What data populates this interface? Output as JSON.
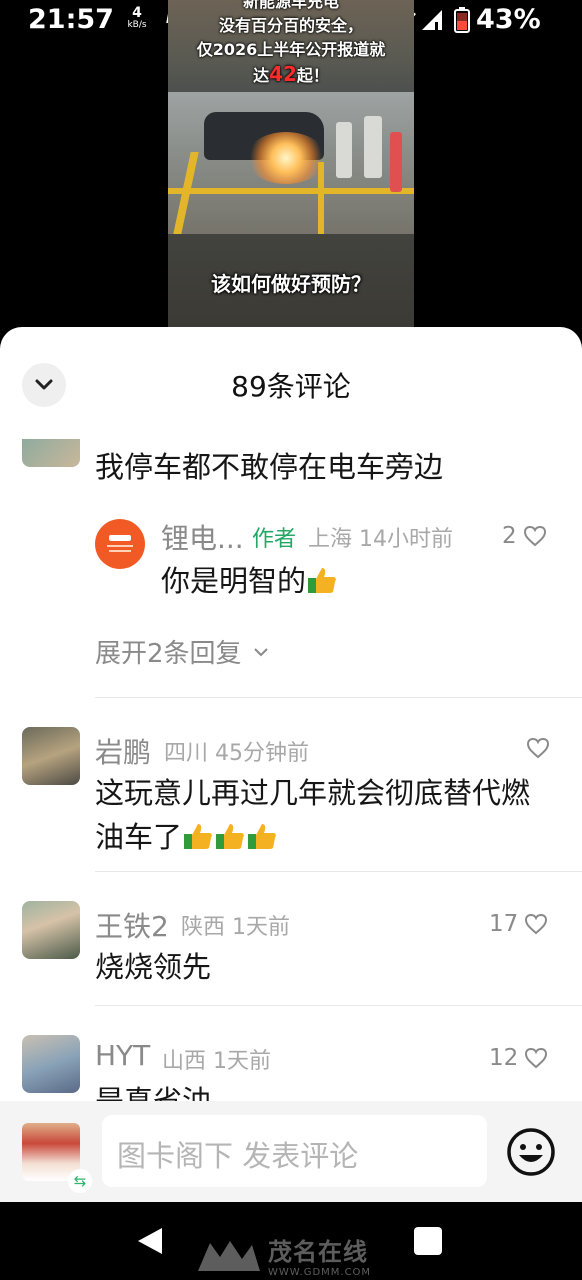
{
  "status_bar": {
    "time": "21:57",
    "net_speed_value": "4",
    "net_speed_unit": "kB/s",
    "hd": "HD",
    "battery_percent": "43%",
    "battery_color": "#ff4a3d"
  },
  "video": {
    "caption_line1": "新能源车充电",
    "caption_line2": "没有百分百的安全，",
    "caption_line3": "仅2026上半年公开报道就",
    "caption_line4_prefix": "达",
    "caption_line4_highlight": "42",
    "caption_line4_suffix": "起！",
    "caption_bottom": "该如何做好预防？"
  },
  "sheet": {
    "title": "89条评论",
    "collapse_icon": "chevron-down-icon"
  },
  "comments": [
    {
      "text": "我停车都不敢停在电车旁边"
    },
    {
      "username": "锂电...",
      "author_tag": "作者",
      "location": "上海",
      "time": "14小时前",
      "likes": "2",
      "text": "你是明智的"
    },
    {
      "expand_label": "展开2条回复"
    },
    {
      "username": "岩鹏",
      "location": "四川",
      "time": "45分钟前",
      "likes": "",
      "text_line1": "这玩意儿再过几年就会彻底替代燃",
      "text_line2": "油车了"
    },
    {
      "username": "王铁2",
      "location": "陕西",
      "time": "1天前",
      "likes": "17",
      "text": "烧烧领先"
    },
    {
      "username": "HYT",
      "location": "山西",
      "time": "1天前",
      "likes": "12",
      "text": "是真省油"
    }
  ],
  "input_bar": {
    "placeholder": "图卡阁下 发表评论",
    "emoji_icon": "smile-icon",
    "swap_icon": "swap-icon"
  },
  "watermark": {
    "title": "茂名在线",
    "url": "WWW.GDMM.COM"
  },
  "colors": {
    "author_tag": "#22a864",
    "highlight_red": "#ff2a2a",
    "caption_yellow": "#e3b62a"
  }
}
